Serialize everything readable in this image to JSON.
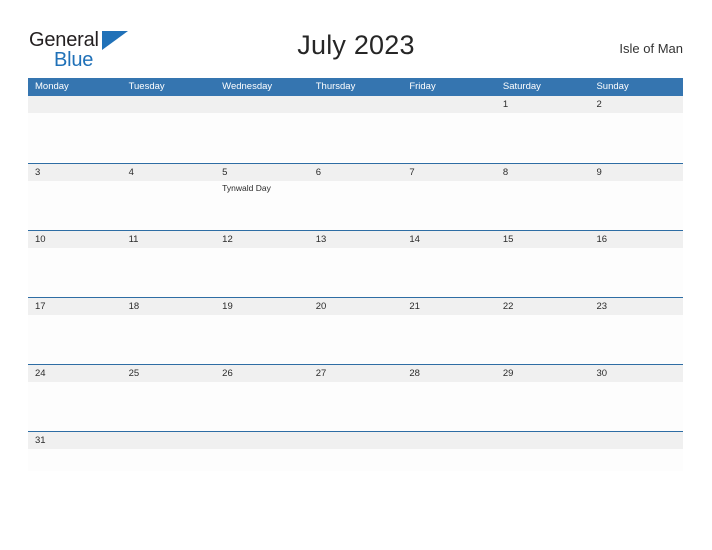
{
  "brand": {
    "name_part1": "General",
    "name_part2": "Blue",
    "flag_icon": "triangle-flag-icon"
  },
  "header": {
    "title": "July 2023",
    "region": "Isle of Man"
  },
  "colors": {
    "header_blue": "#3575b0",
    "rule_blue": "#2e6da4",
    "day_strip_gray": "#f0f0f0",
    "brand_blue": "#2071b8",
    "title_text": "#262626"
  },
  "calendar": {
    "weekdays": [
      "Monday",
      "Tuesday",
      "Wednesday",
      "Thursday",
      "Friday",
      "Saturday",
      "Sunday"
    ],
    "weeks": [
      {
        "days": [
          {
            "num": "",
            "event": ""
          },
          {
            "num": "",
            "event": ""
          },
          {
            "num": "",
            "event": ""
          },
          {
            "num": "",
            "event": ""
          },
          {
            "num": "",
            "event": ""
          },
          {
            "num": "1",
            "event": ""
          },
          {
            "num": "2",
            "event": ""
          }
        ]
      },
      {
        "days": [
          {
            "num": "3",
            "event": ""
          },
          {
            "num": "4",
            "event": ""
          },
          {
            "num": "5",
            "event": "Tynwald Day"
          },
          {
            "num": "6",
            "event": ""
          },
          {
            "num": "7",
            "event": ""
          },
          {
            "num": "8",
            "event": ""
          },
          {
            "num": "9",
            "event": ""
          }
        ]
      },
      {
        "days": [
          {
            "num": "10",
            "event": ""
          },
          {
            "num": "11",
            "event": ""
          },
          {
            "num": "12",
            "event": ""
          },
          {
            "num": "13",
            "event": ""
          },
          {
            "num": "14",
            "event": ""
          },
          {
            "num": "15",
            "event": ""
          },
          {
            "num": "16",
            "event": ""
          }
        ]
      },
      {
        "days": [
          {
            "num": "17",
            "event": ""
          },
          {
            "num": "18",
            "event": ""
          },
          {
            "num": "19",
            "event": ""
          },
          {
            "num": "20",
            "event": ""
          },
          {
            "num": "21",
            "event": ""
          },
          {
            "num": "22",
            "event": ""
          },
          {
            "num": "23",
            "event": ""
          }
        ]
      },
      {
        "days": [
          {
            "num": "24",
            "event": ""
          },
          {
            "num": "25",
            "event": ""
          },
          {
            "num": "26",
            "event": ""
          },
          {
            "num": "27",
            "event": ""
          },
          {
            "num": "28",
            "event": ""
          },
          {
            "num": "29",
            "event": ""
          },
          {
            "num": "30",
            "event": ""
          }
        ]
      },
      {
        "days": [
          {
            "num": "31",
            "event": ""
          },
          {
            "num": "",
            "event": ""
          },
          {
            "num": "",
            "event": ""
          },
          {
            "num": "",
            "event": ""
          },
          {
            "num": "",
            "event": ""
          },
          {
            "num": "",
            "event": ""
          },
          {
            "num": "",
            "event": ""
          }
        ]
      }
    ]
  }
}
